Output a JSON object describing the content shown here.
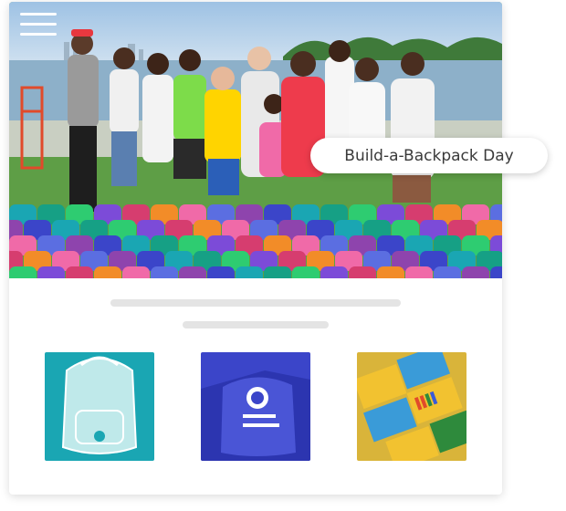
{
  "hero": {
    "badge_label": "Build-a-Backpack Day",
    "colors": {
      "sky": "#bcd4ea",
      "lake": "#8fb2cc",
      "grass": "#5d9f45",
      "accent_red": "#ee3b4c"
    }
  },
  "thumbnails": [
    {
      "name": "backpack-supplies-for-dreams"
    },
    {
      "name": "blue-drawstring-bags"
    },
    {
      "name": "crayon-boxes"
    }
  ]
}
